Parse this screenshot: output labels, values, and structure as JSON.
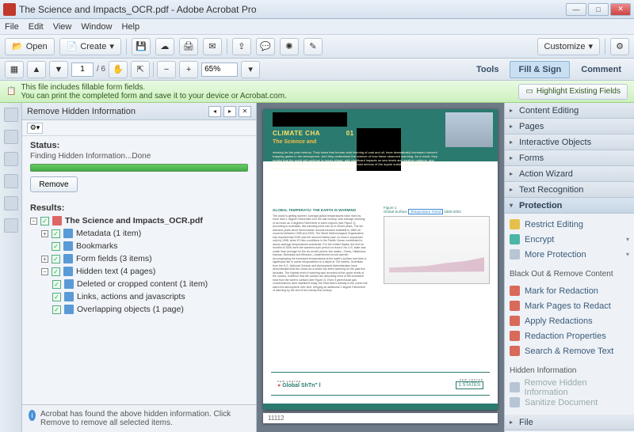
{
  "window": {
    "title": "The Science and Impacts_OCR.pdf - Adobe Acrobat Pro"
  },
  "menu": [
    "File",
    "Edit",
    "View",
    "Window",
    "Help"
  ],
  "toolbar1": {
    "open": "Open",
    "create": "Create",
    "customize": "Customize"
  },
  "toolbar2": {
    "page": "1",
    "pages": "/ 6",
    "zoom": "65%",
    "tools": "Tools",
    "fillsign": "Fill & Sign",
    "comment": "Comment"
  },
  "infobar": {
    "line1": "This file includes fillable form fields.",
    "line2": "You can print the completed form and save it to your device or Acrobat.com.",
    "highlight": "Highlight Existing Fields"
  },
  "leftpanel": {
    "title": "Remove Hidden Information",
    "status_label": "Status:",
    "status_text": "Finding Hidden Information...Done",
    "remove": "Remove",
    "results_label": "Results:",
    "tree": {
      "root": "The Science and Impacts_OCR.pdf",
      "items": [
        "Metadata (1 item)",
        "Bookmarks",
        "Form fields (3 items)",
        "Hidden text (4 pages)",
        "Deleted or cropped content (1 item)",
        "Links, actions and javascripts",
        "Overlapping objects (1 page)"
      ]
    },
    "footer": "Acrobat has found the above hidden information. Click Remove to remove all selected items."
  },
  "doc": {
    "heading1": "CLIMATE CHA",
    "heading1b": "01",
    "heading2": "The Science and",
    "body_title": "GLOBAL TEMPERATU: THE EARTH IS WARMING",
    "fig_caption": "Figure 1",
    "fig_sub": "Global Surface",
    "fig_box": "Temperature Trend",
    "fig_years": "1860-2001",
    "logo1_top": "PEW CENTER",
    "logo1": "Global ShTn\" l",
    "logo2_top": "PEW CENTER",
    "logo2": "1 STATES",
    "pagenum": "11112"
  },
  "rightpanel": {
    "sections": [
      "Content Editing",
      "Pages",
      "Interactive Objects",
      "Forms",
      "Action Wizard",
      "Text Recognition",
      "Protection"
    ],
    "protection": {
      "items1": [
        "Restrict Editing",
        "Encrypt",
        "More Protection"
      ],
      "cap1": "Black Out & Remove Content",
      "items2": [
        "Mark for Redaction",
        "Mark Pages to Redact",
        "Apply Redactions",
        "Redaction Properties",
        "Search & Remove Text"
      ],
      "cap2": "Hidden Information",
      "items3": [
        "Remove Hidden Information",
        "Sanitize Document"
      ]
    },
    "file": "File"
  }
}
